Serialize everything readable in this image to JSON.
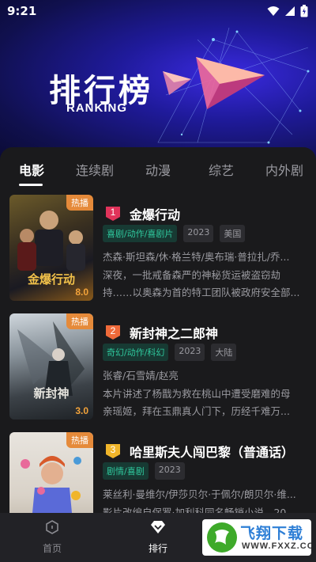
{
  "status": {
    "time": "9:21"
  },
  "banner": {
    "title": "排行榜",
    "subtitle": "RANKING"
  },
  "tabs": [
    {
      "label": "电影",
      "active": true
    },
    {
      "label": "连续剧",
      "active": false
    },
    {
      "label": "动漫",
      "active": false
    },
    {
      "label": "综艺",
      "active": false
    },
    {
      "label": "内外剧",
      "active": false
    }
  ],
  "items": [
    {
      "rank": "1",
      "title": "金爆行动",
      "hot_label": "热播",
      "poster_title": "金爆行动",
      "score": "8.0",
      "genre": "喜剧/动作/喜剧片",
      "year": "2023",
      "region": "美国",
      "cast": "杰森·斯坦森/休·格兰特/奥布瑞·普拉扎/乔...",
      "desc_line1": "深夜，一批戒备森严的神秘货运被盗窃劫",
      "desc_line2": "持……以奥森为首的特工团队被政府安全部..."
    },
    {
      "rank": "2",
      "title": "新封神之二郎神",
      "hot_label": "热播",
      "poster_title": "新封神",
      "score": "3.0",
      "genre": "奇幻/动作/科幻",
      "year": "2023",
      "region": "大陆",
      "cast": "张睿/石雪婧/赵亮",
      "desc_line1": "本片讲述了杨戬为救在桃山中遭受磨难的母",
      "desc_line2": "亲瑶姬，拜在玉鼎真人门下，历经千难万..."
    },
    {
      "rank": "3",
      "title": "哈里斯夫人闯巴黎（普通话）",
      "hot_label": "热播",
      "genre": "剧情/喜剧",
      "year": "2023",
      "cast": "莱丝利·曼维尔/伊莎贝尔·于佩尔/朗贝尔·维...",
      "desc_line1": "影片改编自保罗·加利科同名畅销小说。20..."
    }
  ],
  "nav": [
    {
      "label": "首页",
      "active": false
    },
    {
      "label": "排行",
      "active": true
    }
  ],
  "watermark": {
    "main": "飞翔下载",
    "sub": "WWW.FXXZ.COM"
  },
  "colors": {
    "accent_genre": "#2fc79c",
    "hot": "#e58a3a",
    "rank1": "#e0335a",
    "rank2": "#ef6a3a",
    "rank3": "#f0b52a"
  }
}
